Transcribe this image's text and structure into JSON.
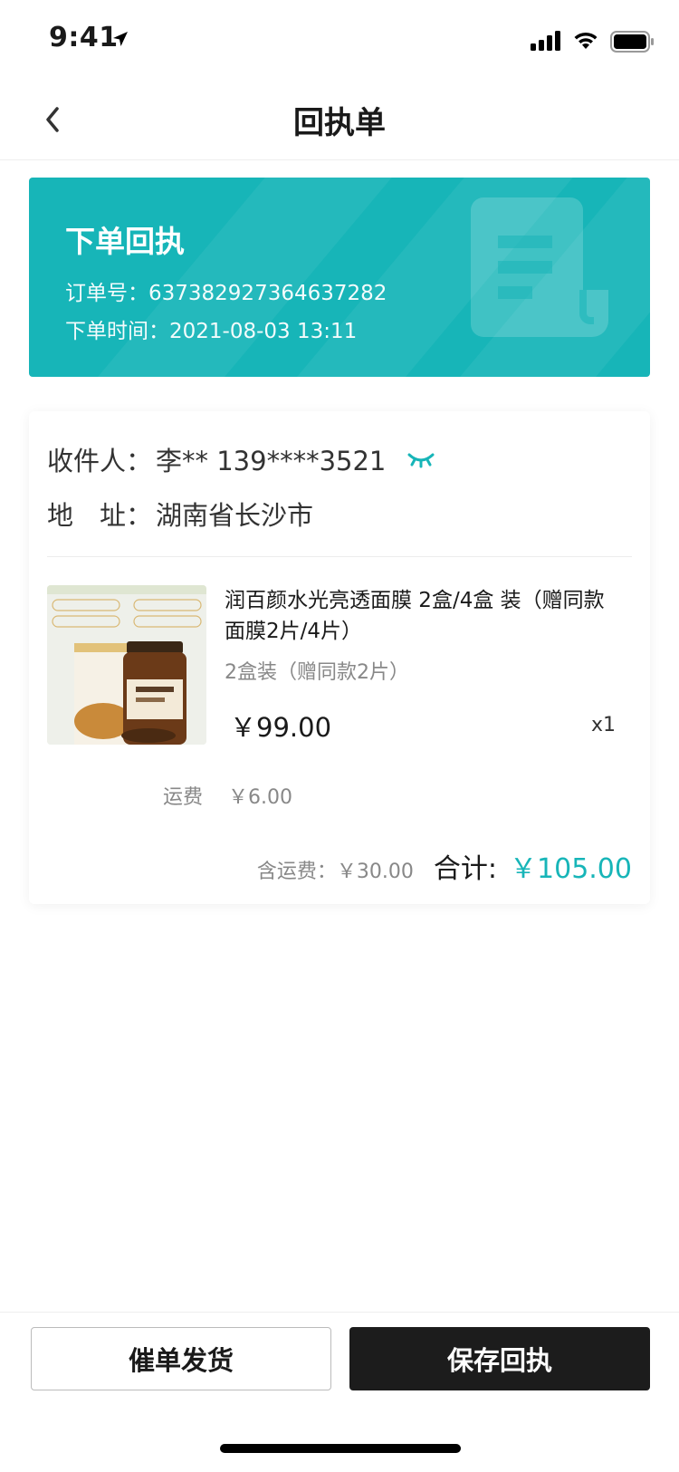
{
  "status_bar": {
    "time": "9:41"
  },
  "nav": {
    "title": "回执单"
  },
  "receipt": {
    "title": "下单回执",
    "order_no_label": "订单号：",
    "order_no": "637382927364637282",
    "order_time_label": "下单时间：",
    "order_time": "2021-08-03 13:11"
  },
  "recipient": {
    "label": "收件人：",
    "value": "李** 139****3521",
    "address_label": "地　址：",
    "address": "湖南省长沙市"
  },
  "product": {
    "name": "润百颜水光亮透面膜 2盒/4盒 装（赠同款面膜2片/4片）",
    "spec": "2盒装（赠同款2片）",
    "price": "￥99.00",
    "qty": "x1"
  },
  "freight": {
    "label": "运费",
    "value": "￥6.00"
  },
  "summary": {
    "shipping_text": "含运费：￥30.00",
    "total_label": "合计:",
    "total": "￥105.00"
  },
  "buttons": {
    "urge": "催单发货",
    "save": "保存回执"
  },
  "colors": {
    "accent": "#17b5b8",
    "dark_button": "#1c1c1c"
  }
}
